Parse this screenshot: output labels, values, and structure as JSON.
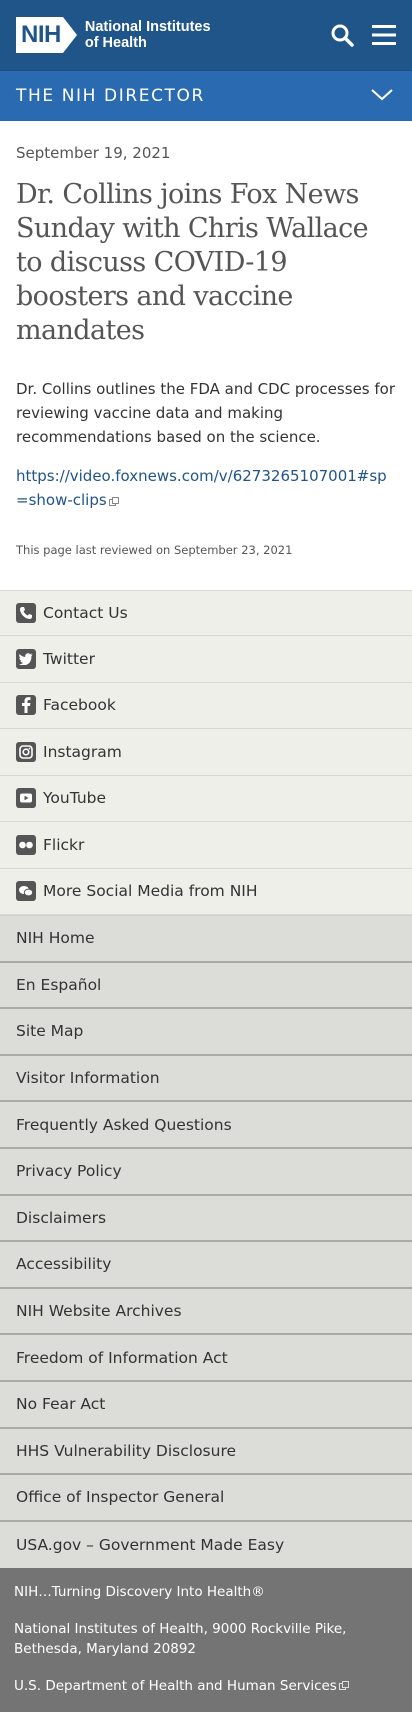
{
  "header": {
    "logo_mark": "NIH",
    "logo_text_line1": "National Institutes",
    "logo_text_line2": "of Health",
    "search_icon": "search-icon",
    "menu_icon": "hamburger-menu-icon"
  },
  "section_bar": {
    "title": "THE NIH DIRECTOR",
    "icon": "chevron-down-icon"
  },
  "article": {
    "date": "September 19, 2021",
    "headline": "Dr. Collins joins Fox News Sunday with Chris Wallace to discuss COVID-19 boosters and vaccine mandates",
    "summary": "Dr. Collins outlines the FDA and CDC processes for reviewing vaccine data and making recommendations based on the science.",
    "link": "https://video.foxnews.com/v/6273265107001#sp=show-clips",
    "reviewed": "This page last reviewed on September 23, 2021"
  },
  "social": [
    {
      "label": "Contact Us",
      "icon": "phone-icon"
    },
    {
      "label": "Twitter",
      "icon": "twitter-icon"
    },
    {
      "label": "Facebook",
      "icon": "facebook-icon"
    },
    {
      "label": "Instagram",
      "icon": "instagram-icon"
    },
    {
      "label": "YouTube",
      "icon": "youtube-icon"
    },
    {
      "label": "Flickr",
      "icon": "flickr-icon"
    },
    {
      "label": "More Social Media from NIH",
      "icon": "chat-bubbles-icon"
    }
  ],
  "footer_links": [
    "NIH Home",
    "En Español",
    "Site Map",
    "Visitor Information",
    "Frequently Asked Questions",
    "Privacy Policy",
    "Disclaimers",
    "Accessibility",
    "NIH Website Archives",
    "Freedom of Information Act",
    "No Fear Act",
    "HHS Vulnerability Disclosure",
    "Office of Inspector General",
    "USA.gov – Government Made Easy"
  ],
  "bottom": {
    "tagline": "NIH…Turning Discovery Into Health®",
    "address": "National Institutes of Health, 9000 Rockville Pike, Bethesda, Maryland 20892",
    "hhs": "U.S. Department of Health and Human Services"
  },
  "colors": {
    "header_bg": "#20558a",
    "section_bar_bg": "#2a6ab0",
    "link": "#20558a",
    "social_bg": "#efefea",
    "footer_links_bg": "#dcdcd8",
    "bottom_bg": "#747474"
  }
}
